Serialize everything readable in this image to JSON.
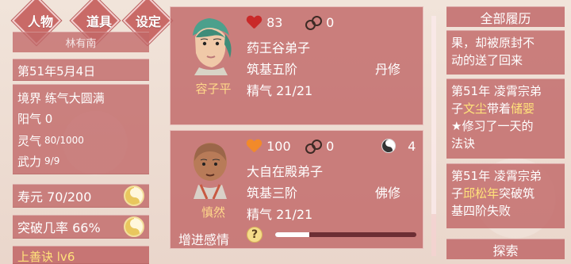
{
  "top_nav": [
    {
      "label": "人物"
    },
    {
      "label": "道具"
    },
    {
      "label": "设定"
    }
  ],
  "left": {
    "name": "林有南",
    "date": "第51年5月4日",
    "realm": "境界 练气大圆满",
    "yang": "阳气 0",
    "spirit_label": "灵气",
    "spirit_value": "80/1000",
    "force_label": "武力",
    "force_value": "9/9",
    "lifespan": "寿元 70/200",
    "breakthrough": "突破几率 66%",
    "bottom_skill": "上善诀 lv6"
  },
  "cards": [
    {
      "name": "容子平",
      "affection": "83",
      "chains": "0",
      "sect": "药王谷弟子",
      "realm": "筑基五阶",
      "path": "丹修",
      "energy": "精气 21/21"
    },
    {
      "name": "慎然",
      "affection": "100",
      "chains": "0",
      "karma": "4",
      "sect": "大自在殿弟子",
      "realm": "筑基三阶",
      "path": "佛修",
      "energy": "精气 21/21",
      "action": "增进感情",
      "bond_progress": 0.24
    }
  ],
  "right": {
    "title": "全部履历",
    "item1_line1": "果，却被原封不",
    "item1_line2": "动的送了回来",
    "item2_line1": "第51年 凌霄宗弟",
    "item2_prefix": "子",
    "item2_name1": "文尘",
    "item2_mid": "带着",
    "item2_name2": "储婴",
    "item2_line3": "★修习了一天的",
    "item2_line4": "法诀",
    "item3_line1": "第51年 凌霄宗弟",
    "item3_prefix": "子",
    "item3_name": "邱松年",
    "item3_suffix": "突破筑",
    "item3_line3": "基四阶失败",
    "search": "探索"
  }
}
